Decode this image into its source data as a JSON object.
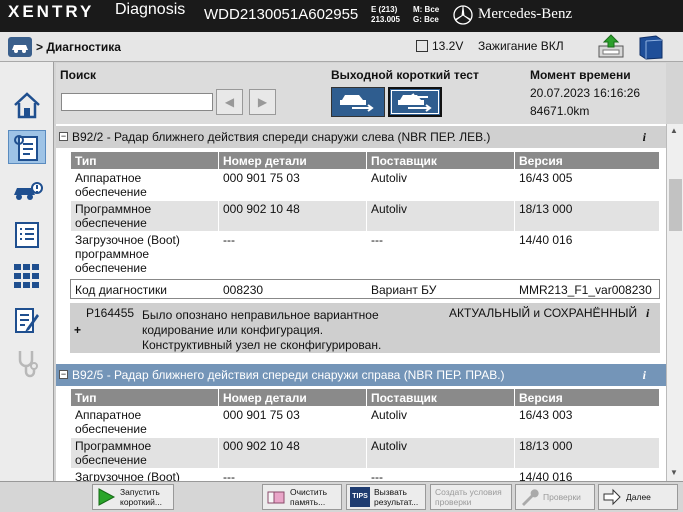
{
  "header": {
    "logo": "XENTRY",
    "app_name": "Diagnosis",
    "vin": "WDD2130051A602955",
    "model_line1": "E (213)",
    "model_line2": "213.005",
    "mode_line1": "M: Все",
    "mode_line2": "G: Все",
    "brand": "Mercedes-Benz"
  },
  "crumb": {
    "path": "> Диагностика",
    "voltage": "13.2V",
    "ignition": "Зажигание ВКЛ"
  },
  "search": {
    "label": "Поиск",
    "value": "",
    "prev": "◀",
    "next": "▶"
  },
  "output_test": {
    "label": "Выходной короткий тест"
  },
  "timestamp": {
    "label": "Момент времени",
    "datetime": "20.07.2023 16:16:26",
    "mileage": "84671.0km"
  },
  "columns": [
    "Тип",
    "Номер детали",
    "Поставщик",
    "Версия"
  ],
  "sections": [
    {
      "toggle": "−",
      "title": "B92/2 - Радар ближнего действия спереди снаружи слева (NBR ПЕР. ЛЕВ.)",
      "info": "i",
      "rows": [
        [
          "Аппаратное обеспечение",
          "000 901 75 03",
          "Autoliv",
          "16/43 005"
        ],
        [
          "Программное обеспечение",
          "000 902 10 48",
          "Autoliv",
          "18/13 000"
        ],
        [
          "Загрузочное (Boot) программное обеспечение",
          "---",
          "---",
          "14/40 016"
        ]
      ],
      "diag": {
        "label": "Код диагностики",
        "code": "008230",
        "variant_label": "Вариант БУ",
        "variant": "MMR213_F1_var008230"
      },
      "fault": {
        "code": "P164455",
        "text": "Было опознано неправильное вариантное кодирование или конфигурация. Конструктивный узел не сконфигурирован.",
        "status": "АКТУАЛЬНЫЙ и СОХРАНЁННЫЙ",
        "expand": "+",
        "info": "i"
      }
    },
    {
      "toggle": "−",
      "title": "B92/5 - Радар ближнего действия спереди снаружи справа (NBR ПЕР. ПРАВ.)",
      "info": "i",
      "rows": [
        [
          "Аппаратное обеспечение",
          "000 901 75 03",
          "Autoliv",
          "16/43 003"
        ],
        [
          "Программное обеспечение",
          "000 902 10 48",
          "Autoliv",
          "18/13 000"
        ],
        [
          "Загрузочное (Boot) программное обеспечение",
          "---",
          "---",
          "14/40 016"
        ]
      ]
    }
  ],
  "bottom": {
    "start_quick": "Запустить короткий...",
    "clear_memory": "Очистить память...",
    "tips_icon": "TIPS",
    "call_result": "Вызвать результат...",
    "create_conditions": "Создать условия проверки",
    "checks": "Проверки",
    "next": "Далее"
  },
  "colors": {
    "header_bg": "#1a1a1a",
    "section_blue": "#7495b8",
    "table_header": "#8a8a8a",
    "active_nav": "#9ec3e6"
  }
}
